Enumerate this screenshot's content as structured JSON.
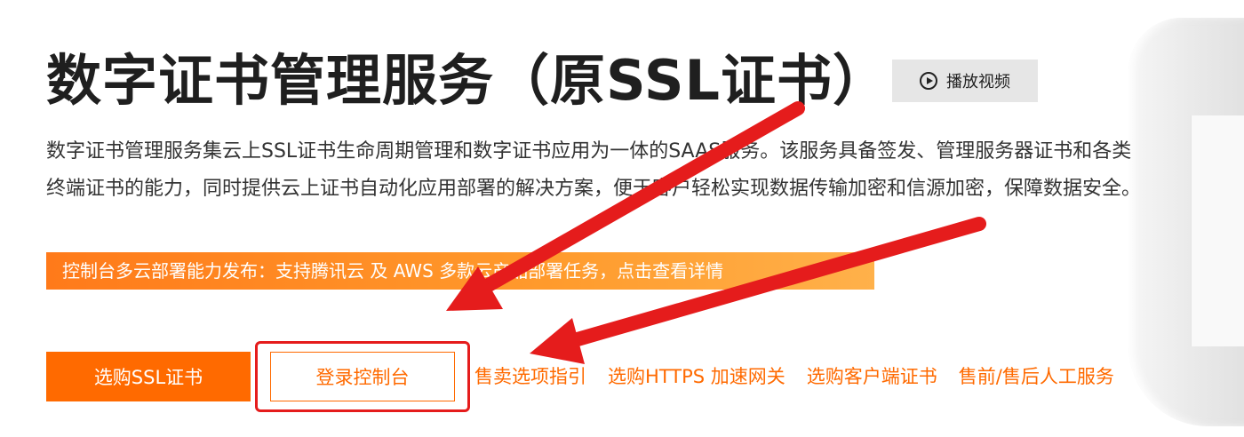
{
  "header": {
    "title": "数字证书管理服务（原SSL证书）",
    "video_button_label": "播放视频"
  },
  "description": "数字证书管理服务集云上SSL证书生命周期管理和数字证书应用为一体的SAAS服务。该服务具备签发、管理服务器证书和各类终端证书的能力，同时提供云上证书自动化应用部署的解决方案，便于客户轻松实现数据传输加密和信源加密，保障数据安全。",
  "banner": {
    "text": "控制台多云部署能力发布：支持腾讯云 及 AWS 多款云产品部署任务，点击查看详情"
  },
  "actions": {
    "buy_label": "选购SSL证书",
    "console_label": "登录控制台",
    "links": [
      "售卖选项指引",
      "选购HTTPS 加速网关",
      "选购客户端证书",
      "售前/售后人工服务"
    ]
  },
  "colors": {
    "brand_orange": "#ff6a00",
    "annotation_red": "#e51c1c",
    "video_button_bg": "#e6e6e6"
  }
}
